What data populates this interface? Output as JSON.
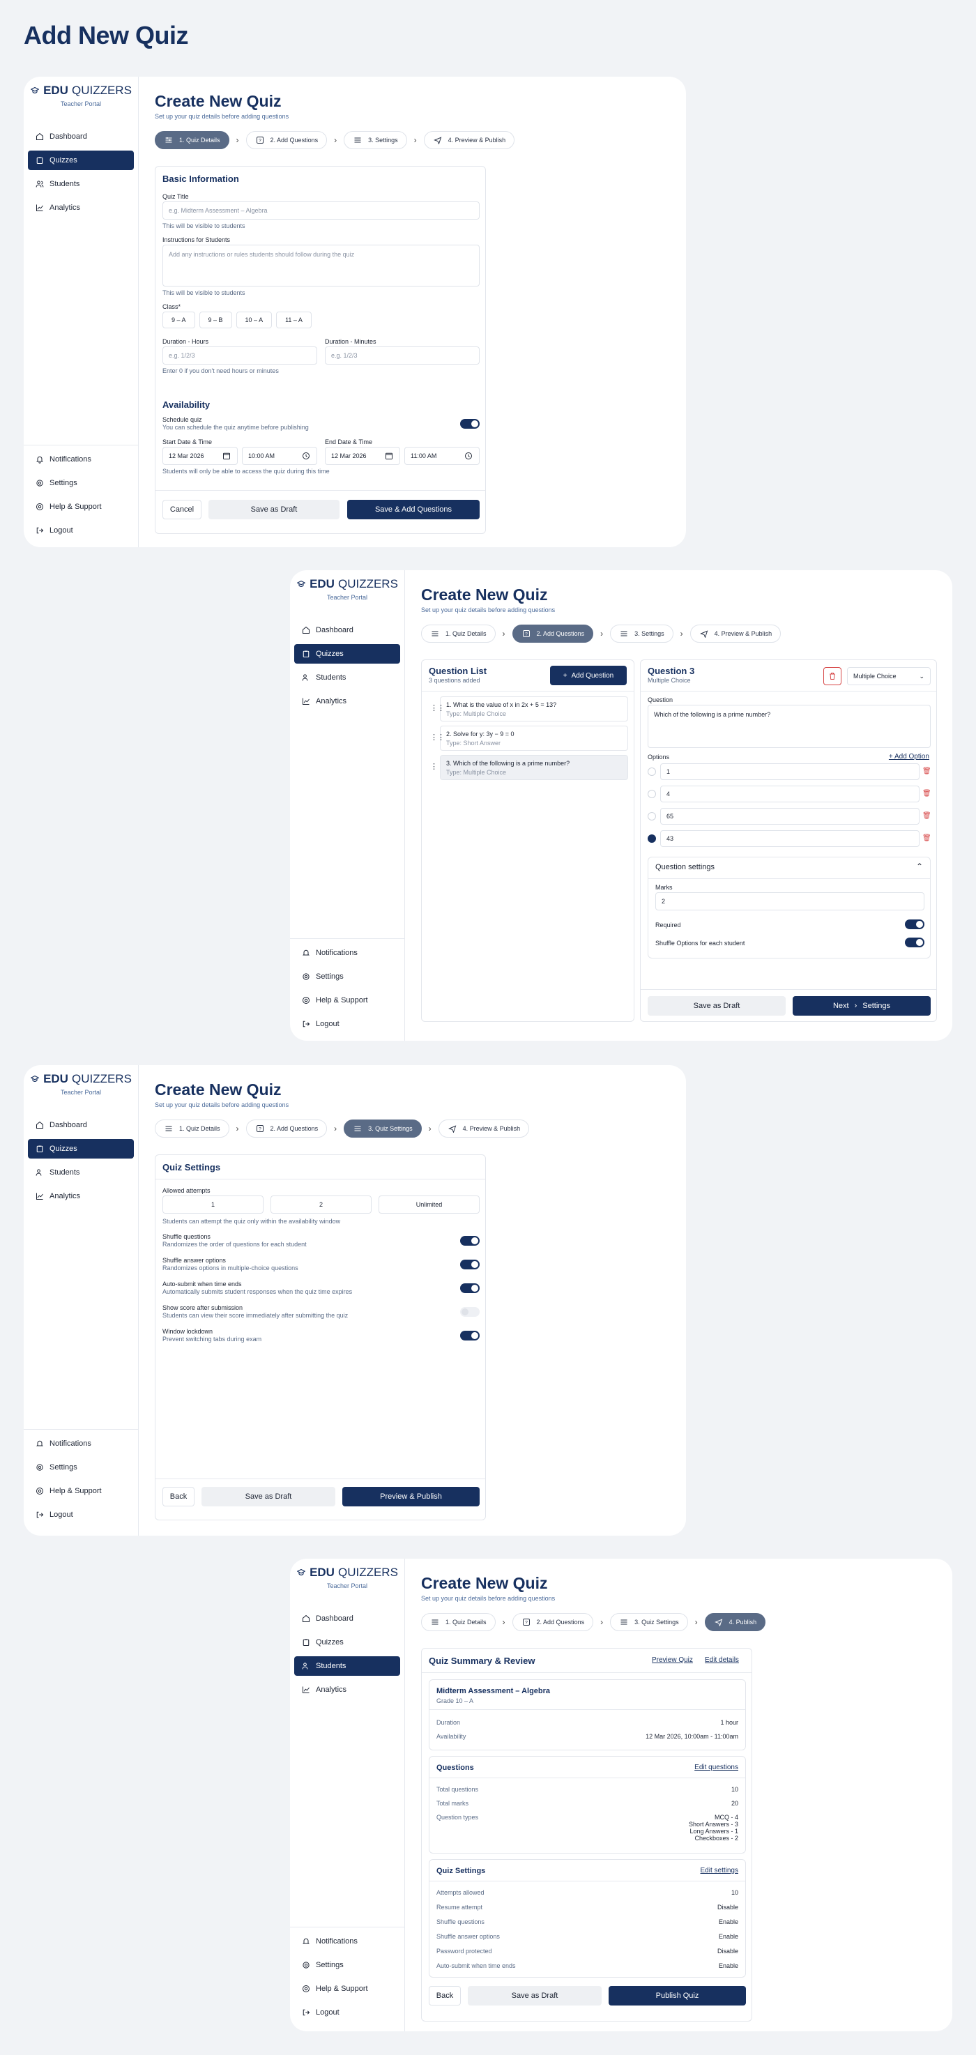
{
  "page_title": "Add New Quiz",
  "brand": {
    "edu": "EDU",
    "quizzers": "QUIZZERS",
    "portal": "Teacher Portal"
  },
  "nav": {
    "dashboard": "Dashboard",
    "quizzes": "Quizzes",
    "students": "Students",
    "analytics": "Analytics",
    "notifications": "Notifications",
    "settings": "Settings",
    "help": "Help & Support",
    "logout": "Logout"
  },
  "header": {
    "title": "Create New Quiz",
    "subtitle": "Set up your quiz details before adding questions"
  },
  "steps_a": [
    "1. Quiz Details",
    "2. Add Questions",
    "3. Settings",
    "4. Preview & Publish"
  ],
  "steps_c": [
    "1. Quiz Details",
    "2. Add Questions",
    "3. Quiz Settings",
    "4. Preview & Publish"
  ],
  "steps_d": [
    "1. Quiz Details",
    "2. Add Questions",
    "3. Quiz Settings",
    "4. Publish"
  ],
  "details": {
    "basic_title": "Basic Information",
    "quiz_title_label": "Quiz Title",
    "quiz_title_placeholder": "e.g. Midterm Assessment – Algebra",
    "quiz_title_hint": "This will be visible to students",
    "instructions_label": "Instructions for Students",
    "instructions_placeholder": "Add any instructions or rules students should follow during the quiz",
    "instructions_hint": "This will be visible to students",
    "class_label": "Class*",
    "classes": [
      "9 – A",
      "9 – B",
      "10 – A",
      "11 – A"
    ],
    "hours_label": "Duration - Hours",
    "hours_placeholder": "e.g. 1/2/3",
    "minutes_label": "Duration - Minutes",
    "minutes_placeholder": "e.g. 1/2/3",
    "duration_hint": "Enter 0 if you don't need hours or minutes",
    "availability_title": "Availability",
    "schedule_label": "Schedule quiz",
    "schedule_hint": "You can schedule the quiz anytime before publishing",
    "start_label": "Start Date & Time",
    "start_date": "12 Mar 2026",
    "start_time": "10:00 AM",
    "end_label": "End Date & Time",
    "end_date": "12 Mar 2026",
    "end_time": "11:00 AM",
    "window_hint": "Students will only be able to access the quiz during this time",
    "cancel": "Cancel",
    "draft": "Save as Draft",
    "save_add": "Save & Add Questions"
  },
  "questions": {
    "list_title": "Question List",
    "list_count": "3 questions added",
    "add_btn": "Add Question",
    "items": [
      {
        "title": "1. What is the value of x in 2x + 5 = 13?",
        "type": "Type: Multiple Choice"
      },
      {
        "title": "2. Solve for y: 3y − 9 = 0",
        "type": "Type: Short Answer"
      },
      {
        "title": "3. Which of the following is a prime number?",
        "type": "Type: Multiple Choice"
      }
    ],
    "editor_title": "Question 3",
    "editor_type": "Multiple Choice",
    "type_select": "Multiple Choice",
    "question_label": "Question",
    "question_text": "Which of the following is a prime number?",
    "options_label": "Options",
    "add_option": "+ Add Option",
    "options": [
      "1",
      "4",
      "65",
      "43"
    ],
    "settings_title": "Question settings",
    "marks_label": "Marks",
    "marks_value": "2",
    "required": "Required",
    "shuffle": "Shuffle Options for each student",
    "draft": "Save as Draft",
    "next": "Next",
    "next_target": "Settings"
  },
  "quiz_settings": {
    "title": "Quiz Settings",
    "attempts_label": "Allowed attempts",
    "attempts": [
      "1",
      "2",
      "Unlimited"
    ],
    "attempts_hint": "Students can attempt the quiz only within the availability window",
    "rows": [
      {
        "label": "Shuffle questions",
        "hint": "Randomizes the order of questions for each student",
        "on": true
      },
      {
        "label": "Shuffle answer options",
        "hint": "Randomizes options in multiple-choice questions",
        "on": true
      },
      {
        "label": "Auto-submit when time ends",
        "hint": "Automatically submits student responses when the quiz time expires",
        "on": true
      },
      {
        "label": "Show score after submission",
        "hint": "Students can view their score immediately after submitting the quiz",
        "on": false
      },
      {
        "label": "Window lockdown",
        "hint": "Prevent switching tabs during exam",
        "on": true
      }
    ],
    "back": "Back",
    "draft": "Save as Draft",
    "preview": "Preview & Publish"
  },
  "review": {
    "title": "Quiz Summary & Review",
    "preview_link": "Preview Quiz",
    "edit_link": "Edit details",
    "quiz_name": "Midterm Assessment – Algebra",
    "quiz_grade": "Grade 10 – A",
    "duration_k": "Duration",
    "duration_v": "1 hour",
    "availability_k": "Availability",
    "availability_v": "12 Mar 2026, 10:00am - 11:00am",
    "q_title": "Questions",
    "q_edit": "Edit questions",
    "total_q_k": "Total questions",
    "total_q_v": "10",
    "total_m_k": "Total marks",
    "total_m_v": "20",
    "types_k": "Question types",
    "types_v": [
      "MCQ - 4",
      "Short Answers - 3",
      "Long Answers - 1",
      "Checkboxes - 2"
    ],
    "s_title": "Quiz Settings",
    "s_edit": "Edit settings",
    "settings": [
      {
        "k": "Attempts allowed",
        "v": "10"
      },
      {
        "k": "Resume attempt",
        "v": "Disable"
      },
      {
        "k": "Shuffle questions",
        "v": "Enable"
      },
      {
        "k": "Shuffle answer options",
        "v": "Enable"
      },
      {
        "k": "Password protected",
        "v": "Disable"
      },
      {
        "k": "Auto-submit when time ends",
        "v": "Enable"
      }
    ],
    "back": "Back",
    "draft": "Save as Draft",
    "publish": "Publish Quiz"
  }
}
